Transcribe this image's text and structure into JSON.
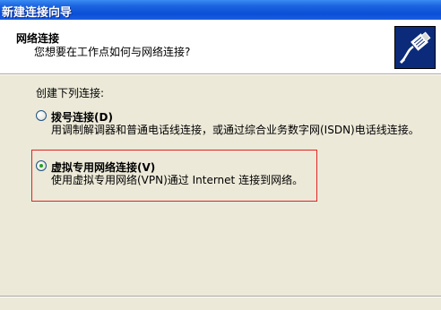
{
  "window": {
    "title": "新建连接向导"
  },
  "header": {
    "title": "网络连接",
    "subtitle": "您想要在工作点如何与网络连接?",
    "icon": "network-cable-plug-icon"
  },
  "main": {
    "prompt": "创建下列连接:",
    "options": [
      {
        "label": "拨号连接(D)",
        "description": "用调制解调器和普通电话线连接，或通过综合业务数字网(ISDN)电话线连接。",
        "selected": false
      },
      {
        "label": "虚拟专用网络连接(V)",
        "description": "使用虚拟专用网络(VPN)通过 Internet 连接到网络。",
        "selected": true
      }
    ]
  },
  "colors": {
    "title_bar": "#0a4fd6",
    "highlight_border": "#e02424",
    "window_bg": "#ece9d8",
    "radio_dot": "#21a121"
  }
}
